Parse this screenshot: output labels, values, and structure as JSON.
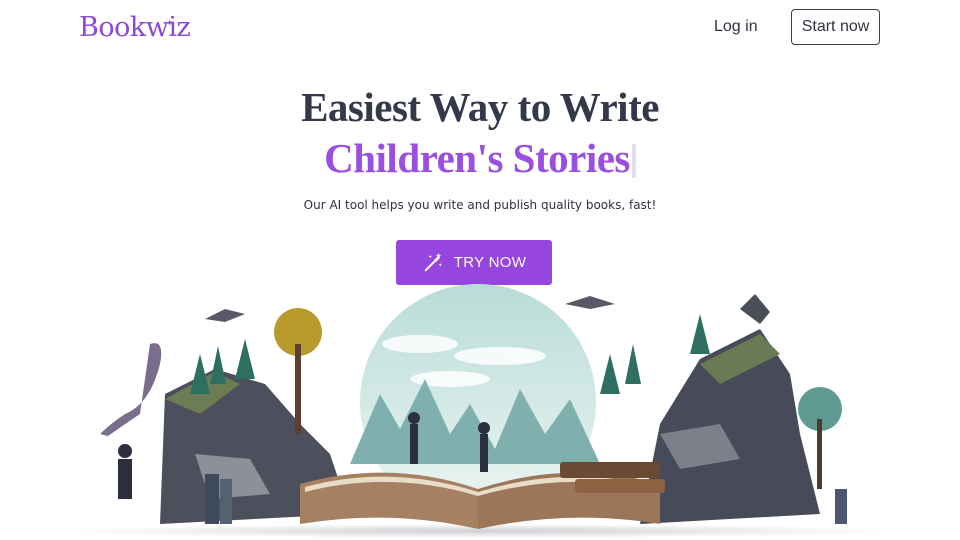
{
  "brand": {
    "name_part1": "Book",
    "name_part2": "wiz"
  },
  "nav": {
    "login_label": "Log in",
    "start_label": "Start now"
  },
  "hero": {
    "headline_line1": "Easiest Way to Write",
    "headline_line2": "Children's Stories",
    "subtitle": "Our AI tool helps you write and publish quality books, fast!",
    "cta_label": "TRY NOW",
    "cta_icon": "magic-wand-icon"
  },
  "colors": {
    "accent": "#9645de",
    "heading": "#33384a",
    "highlight": "#9a4fe0"
  }
}
